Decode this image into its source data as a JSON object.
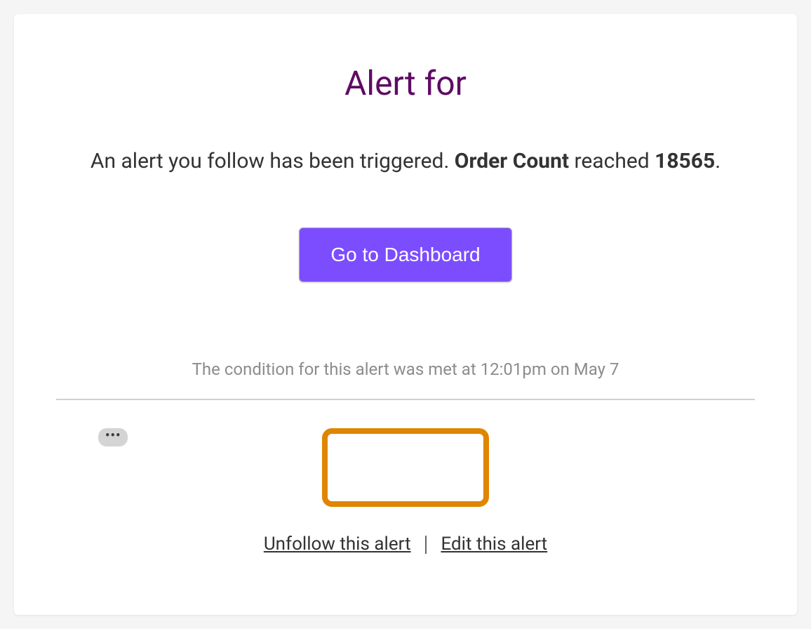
{
  "title": "Alert for",
  "description": {
    "prefix": "An alert you follow has been triggered. ",
    "metric_name": "Order Count",
    "middle": " reached ",
    "value": "18565",
    "suffix": "."
  },
  "primary_button_label": "Go to Dashboard",
  "condition_text": "The condition for this alert was met at 12:01pm on May 7",
  "ellipsis": "•••",
  "footer": {
    "unfollow_label": "Unfollow this alert",
    "edit_label": "Edit this alert"
  }
}
